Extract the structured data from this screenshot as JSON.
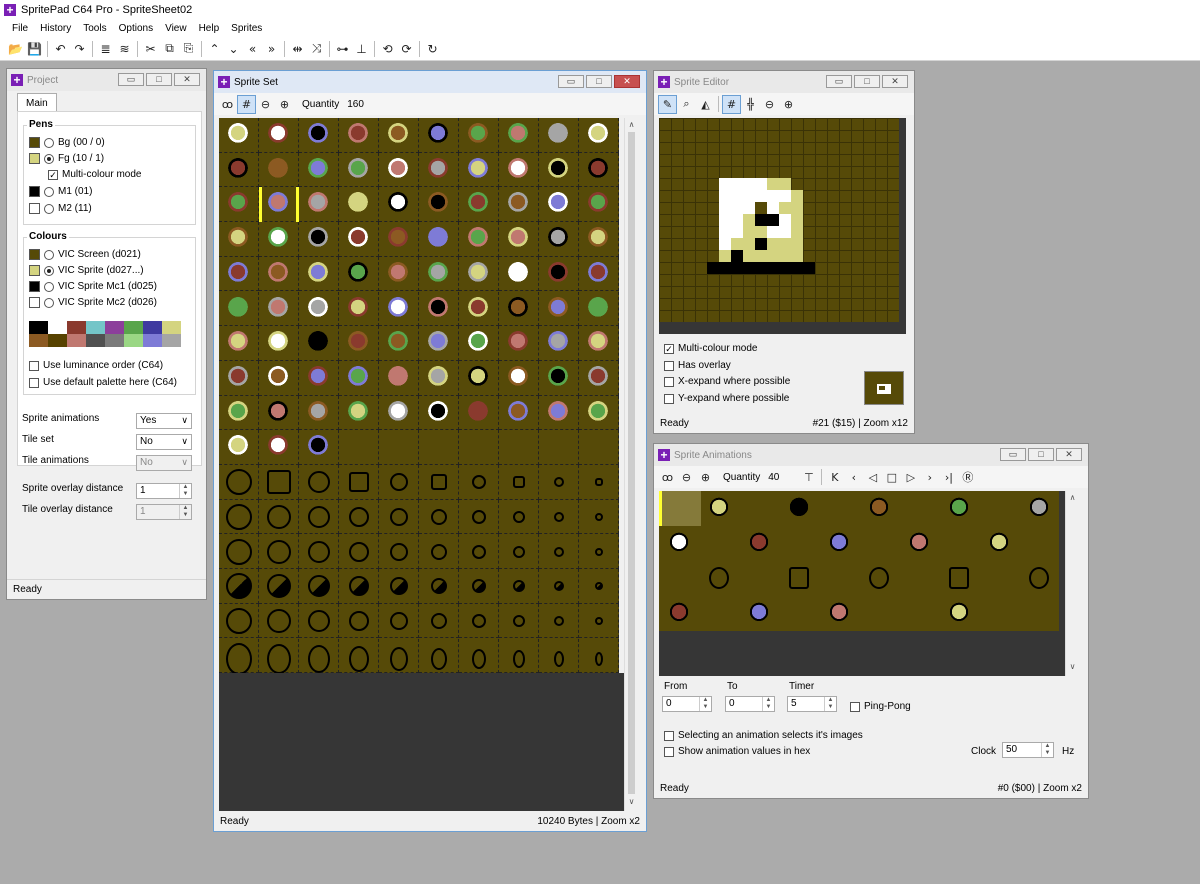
{
  "app": {
    "title": "SpritePad C64 Pro - SpriteSheet02",
    "logo": "+"
  },
  "menu": [
    "File",
    "History",
    "Tools",
    "Options",
    "View",
    "Help",
    "Sprites"
  ],
  "toolbar_icons": [
    "open-icon",
    "save-icon",
    "undo-icon",
    "redo-icon",
    "align-icon",
    "stack-icon",
    "cut-icon",
    "copy-icon",
    "paste-icon",
    "shift-up-icon",
    "shift-down-icon",
    "shift-left-icon",
    "shift-right-icon",
    "flip-horizontal-icon",
    "flip-vertical-icon",
    "mirror-h-icon",
    "mirror-v-icon",
    "rotate-left-icon",
    "rotate-right-icon",
    "refresh-icon"
  ],
  "project": {
    "title": "Project",
    "tab": "Main",
    "pens_label": "Pens",
    "pens": [
      {
        "label": "Bg (00 / 0)",
        "color": "#564a08",
        "type": "radio",
        "selected": false
      },
      {
        "label": "Fg (10 / 1)",
        "color": "#d4d480",
        "type": "radio",
        "selected": true
      },
      {
        "label": "Multi-colour mode",
        "color": "",
        "type": "check",
        "checked": true
      },
      {
        "label": "M1 (01)",
        "color": "#000000",
        "type": "radio",
        "selected": false
      },
      {
        "label": "M2 (11)",
        "color": "#ffffff",
        "type": "radio",
        "selected": false
      }
    ],
    "colours_label": "Colours",
    "colours": [
      {
        "label": "VIC Screen (d021)",
        "color": "#564a08",
        "selected": false
      },
      {
        "label": "VIC Sprite (d027...)",
        "color": "#d4d480",
        "selected": true
      },
      {
        "label": "VIC Sprite Mc1 (d025)",
        "color": "#000000",
        "selected": false
      },
      {
        "label": "VIC Sprite Mc2 (d026)",
        "color": "#ffffff",
        "selected": false
      }
    ],
    "palette": [
      "#000000",
      "#ffffff",
      "#8a3a2e",
      "#74c5c8",
      "#8c3f9b",
      "#59a54b",
      "#3f3aa0",
      "#d4d480",
      "#8c5a22",
      "#574200",
      "#c07870",
      "#505050",
      "#7b7b7b",
      "#9ad784",
      "#7e7bd6",
      "#a5a5a5"
    ],
    "use_luminance": "Use luminance order (C64)",
    "use_default_palette": "Use default palette here (C64)",
    "sprite_animations_label": "Sprite animations",
    "sprite_animations_value": "Yes",
    "tile_set_label": "Tile set",
    "tile_set_value": "No",
    "tile_animations_label": "Tile animations",
    "tile_animations_value": "No",
    "sprite_overlay_label": "Sprite overlay distance",
    "sprite_overlay_value": "1",
    "tile_overlay_label": "Tile overlay distance",
    "tile_overlay_value": "1",
    "status": "Ready"
  },
  "sprite_set": {
    "title": "Sprite Set",
    "quantity_label": "Quantity",
    "quantity_value": "160",
    "status_left": "Ready",
    "status_right": "10240 Bytes | Zoom x2"
  },
  "sprite_editor": {
    "title": "Sprite Editor",
    "multicolour": "Multi-colour mode",
    "has_overlay": "Has overlay",
    "x_expand": "X-expand where possible",
    "y_expand": "Y-expand where possible",
    "status_left": "Ready",
    "status_right": "#21 ($15) | Zoom x12"
  },
  "sprite_animations": {
    "title": "Sprite Animations",
    "quantity_label": "Quantity",
    "quantity_value": "40",
    "from_label": "From",
    "from_value": "0",
    "to_label": "To",
    "to_value": "0",
    "timer_label": "Timer",
    "timer_value": "5",
    "ping_pong": "Ping-Pong",
    "selecting": "Selecting an animation selects it's images",
    "show_hex": "Show animation values in hex",
    "clock_label": "Clock",
    "clock_value": "50",
    "hz": "Hz",
    "status_left": "Ready",
    "status_right": "#0 ($00) | Zoom x2"
  }
}
